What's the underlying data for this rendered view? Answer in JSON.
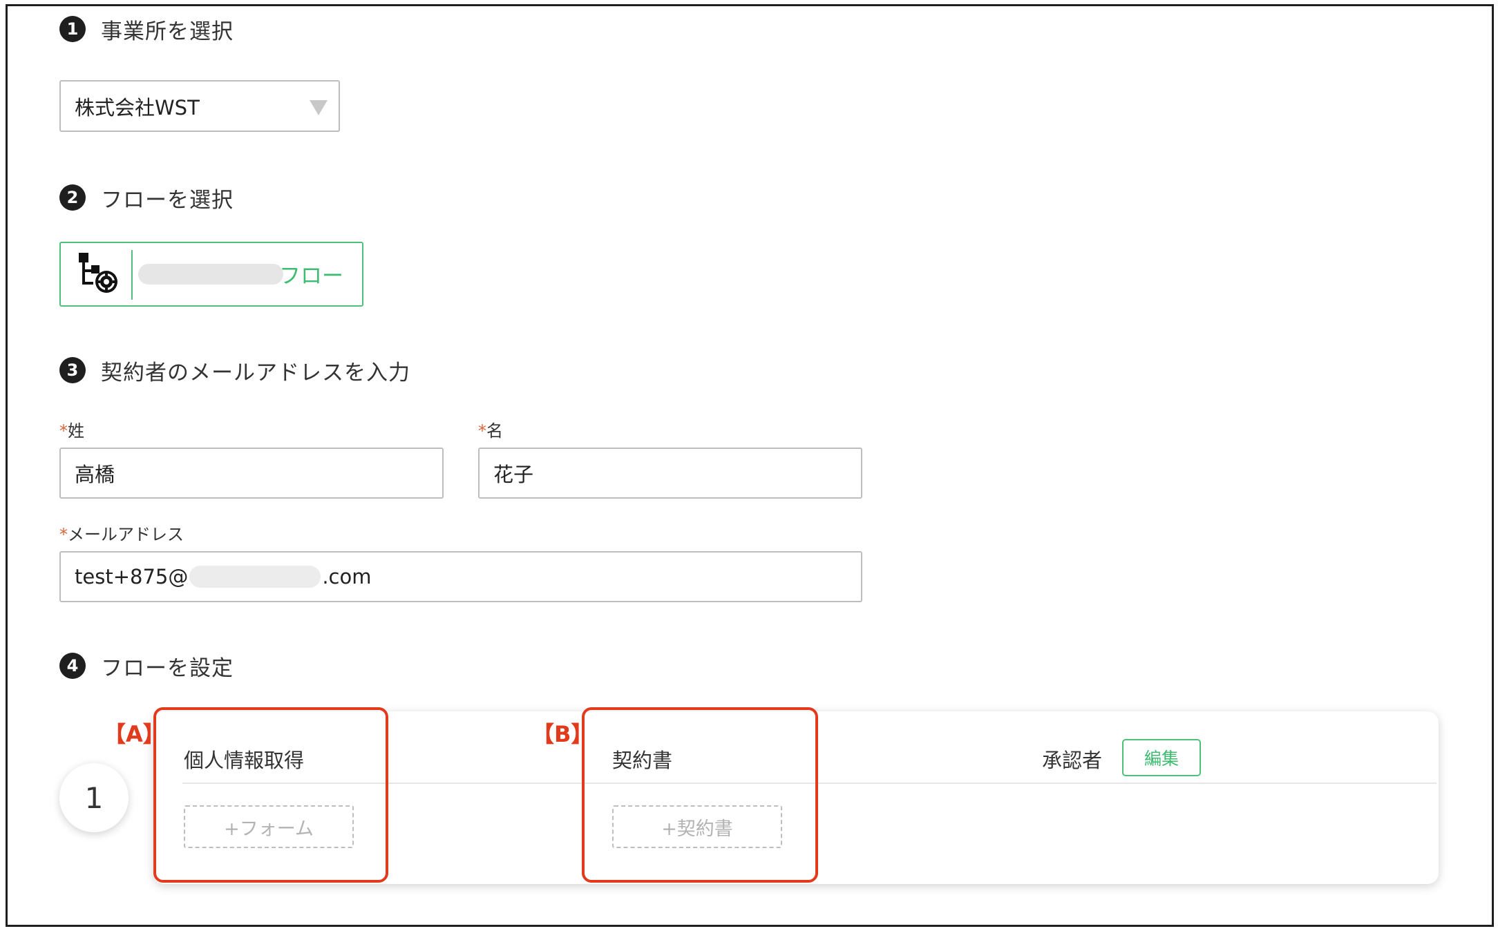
{
  "steps": [
    {
      "number": "1",
      "title": "事業所を選択"
    },
    {
      "number": "2",
      "title": "フローを選択"
    },
    {
      "number": "3",
      "title": "契約者のメールアドレスを入力"
    },
    {
      "number": "4",
      "title": "フローを設定"
    }
  ],
  "office_select": {
    "value": "株式会社WST"
  },
  "flow": {
    "label": "フロー"
  },
  "contract_form": {
    "required_mark": "*",
    "last_name_label": "姓",
    "last_name_value": "高橋",
    "first_name_label": "名",
    "first_name_value": "花子",
    "email_label": "メールアドレス",
    "email_prefix": "test+875@",
    "email_suffix": ".com"
  },
  "flow_setting": {
    "row_number": "1",
    "personal_info_title": "個人情報取得",
    "add_form_label": "+フォーム",
    "contract_title": "契約書",
    "add_contract_label": "+契約書",
    "approver_label": "承認者",
    "edit_label": "編集"
  },
  "annotations": {
    "a": "【A】",
    "b": "【B】"
  },
  "colors": {
    "accent_green": "#3dbb6f",
    "annotation_red": "#e23a1c",
    "required_orange": "#e0643a"
  }
}
